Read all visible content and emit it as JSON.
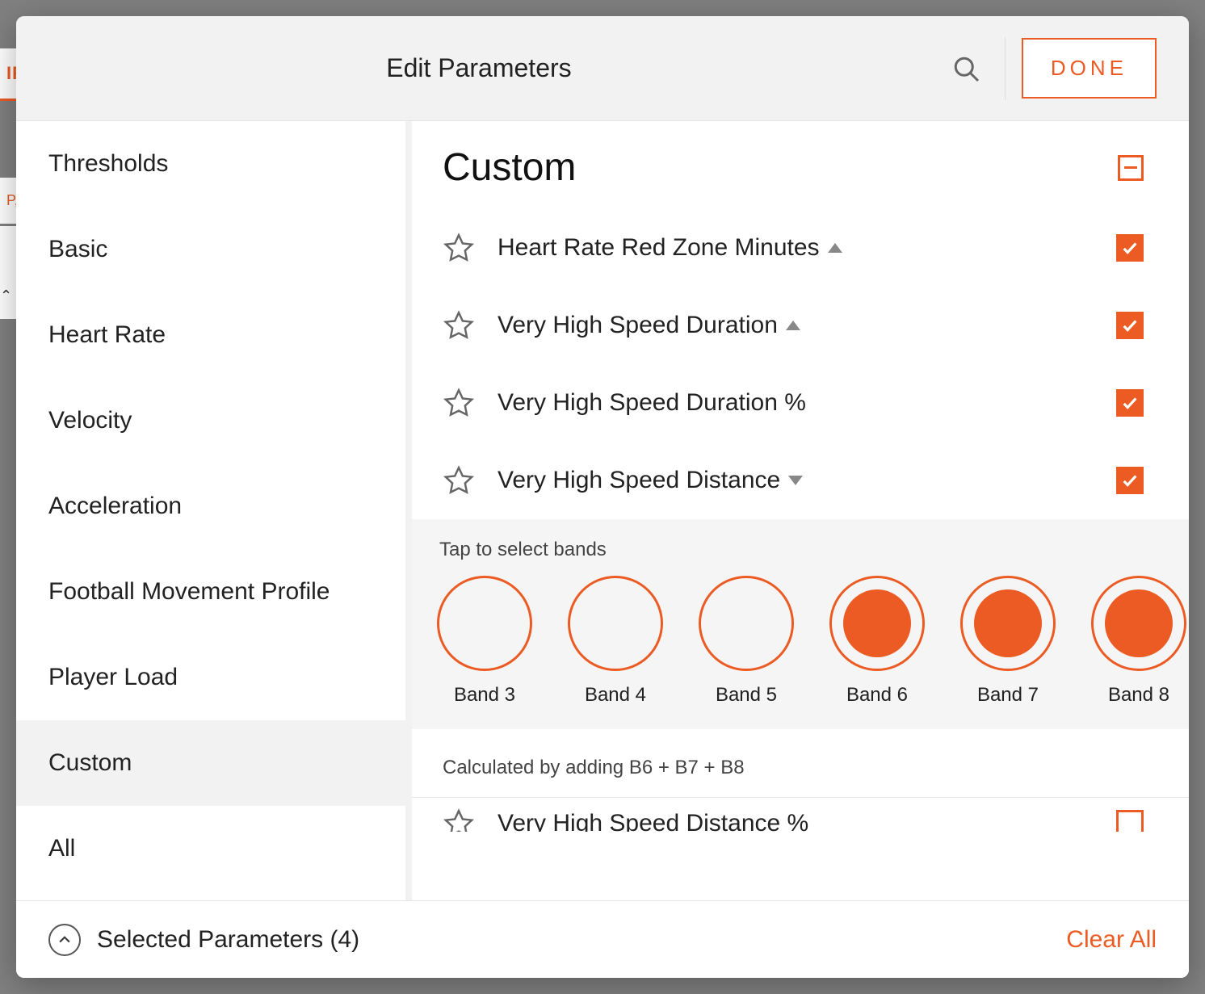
{
  "background": {
    "tab_fragment": "IF",
    "row_fragment": "P,",
    "caret": "⌃"
  },
  "modal": {
    "title": "Edit Parameters",
    "done_label": "DONE"
  },
  "sidebar": {
    "items": [
      {
        "label": "Thresholds"
      },
      {
        "label": "Basic"
      },
      {
        "label": "Heart Rate"
      },
      {
        "label": "Velocity"
      },
      {
        "label": "Acceleration"
      },
      {
        "label": "Football Movement Profile"
      },
      {
        "label": "Player Load"
      },
      {
        "label": "Custom"
      },
      {
        "label": "All"
      }
    ],
    "active_index": 7
  },
  "section": {
    "title": "Custom",
    "params": [
      {
        "label": "Heart Rate Red Zone Minutes",
        "arrow": "up",
        "checked": true
      },
      {
        "label": "Very High Speed Duration",
        "arrow": "up",
        "checked": true
      },
      {
        "label": "Very High Speed Duration %",
        "arrow": "none",
        "checked": true
      },
      {
        "label": "Very High Speed Distance",
        "arrow": "down",
        "checked": true
      }
    ],
    "partial_param": {
      "label": "Very High Speed Distance %",
      "checked": false
    }
  },
  "bands_panel": {
    "hint": "Tap to select bands",
    "bands": [
      {
        "label": "Band 3",
        "selected": false
      },
      {
        "label": "Band 4",
        "selected": false
      },
      {
        "label": "Band 5",
        "selected": false
      },
      {
        "label": "Band 6",
        "selected": true
      },
      {
        "label": "Band 7",
        "selected": true
      },
      {
        "label": "Band 8",
        "selected": true
      }
    ],
    "calc_note": "Calculated by adding B6 + B7 + B8"
  },
  "footer": {
    "selected_label": "Selected Parameters (4)",
    "clear_all_label": "Clear All"
  },
  "colors": {
    "accent": "#ec5b23"
  }
}
